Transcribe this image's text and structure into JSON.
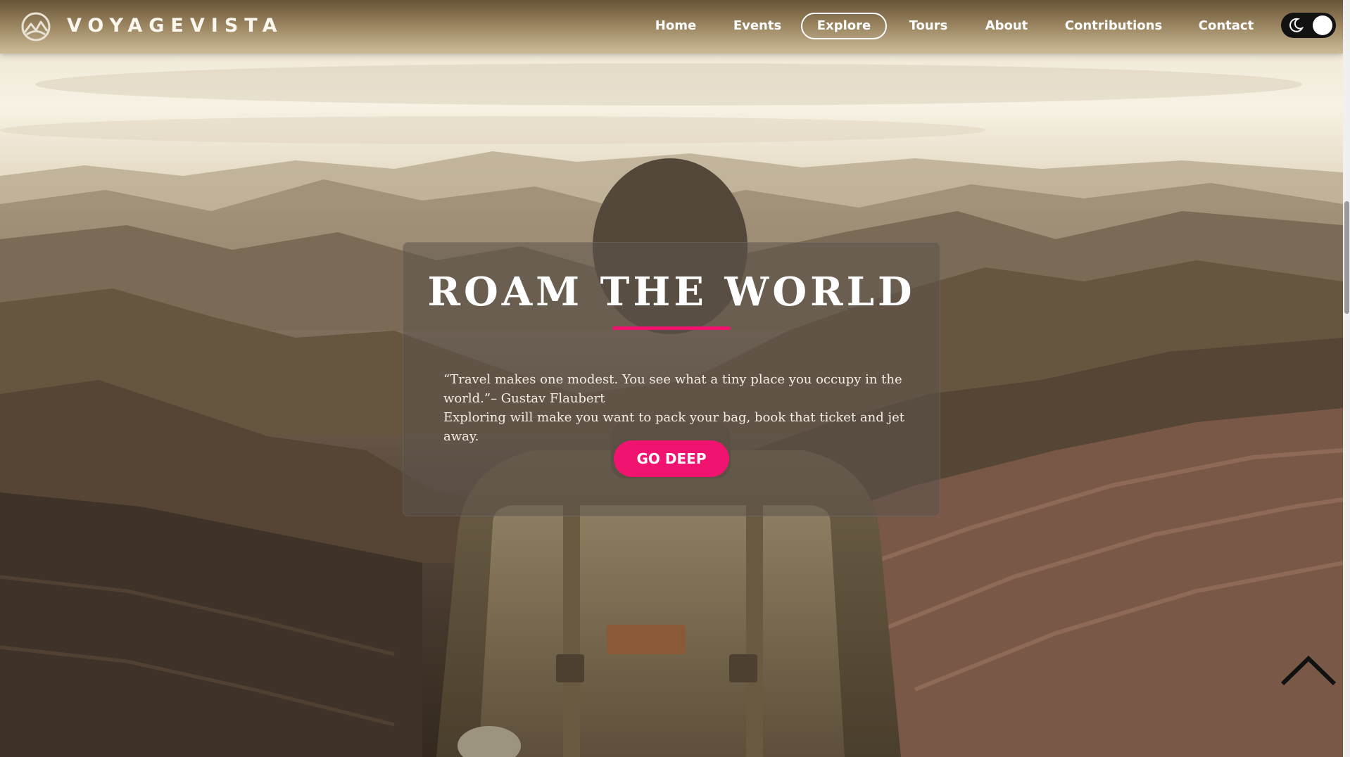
{
  "brand": {
    "name": "VOYAGEVISTA",
    "logo_icon": "mountain-logo-icon"
  },
  "nav": {
    "items": [
      {
        "label": "Home",
        "active": false
      },
      {
        "label": "Events",
        "active": false
      },
      {
        "label": "Explore",
        "active": true
      },
      {
        "label": "Tours",
        "active": false
      },
      {
        "label": "About",
        "active": false
      },
      {
        "label": "Contributions",
        "active": false
      },
      {
        "label": "Contact",
        "active": false
      }
    ],
    "theme_toggle": {
      "icon": "moon-icon",
      "state": "dark"
    }
  },
  "hero": {
    "title": "ROAM THE WORLD",
    "quote_line1": "“Travel makes one modest. You see what a tiny place you occupy in the world.”– Gustav Flaubert",
    "quote_line2": "Exploring will make you want to pack your bag, book that ticket and jet away.",
    "cta_label": "GO DEEP"
  },
  "scroll_top": {
    "icon": "chevron-up-icon"
  },
  "colors": {
    "accent": "#f0136f",
    "nav_gradient_top": "#5c482a",
    "card_bg": "#5c544c"
  }
}
